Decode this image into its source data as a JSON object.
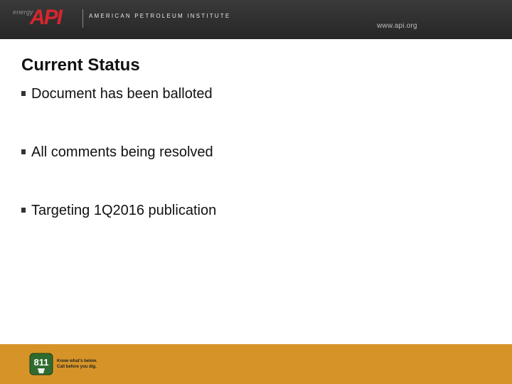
{
  "header": {
    "logo_energy": "energy",
    "logo_api": "API",
    "org_name": "AMERICAN PETROLEUM INSTITUTE",
    "url": "www.api.org"
  },
  "slide": {
    "title": "Current Status",
    "bullets": [
      "Document has been balloted",
      "All comments being resolved",
      "Targeting 1Q2016 publication"
    ]
  },
  "footer": {
    "badge_number": "811",
    "badge_line1": "Know what's below.",
    "badge_line2": "Call before you dig."
  },
  "colors": {
    "header_bg": "#2f2f2f",
    "api_red": "#d7262e",
    "footer_orange": "#d69428",
    "badge_green": "#2f6b2f"
  }
}
